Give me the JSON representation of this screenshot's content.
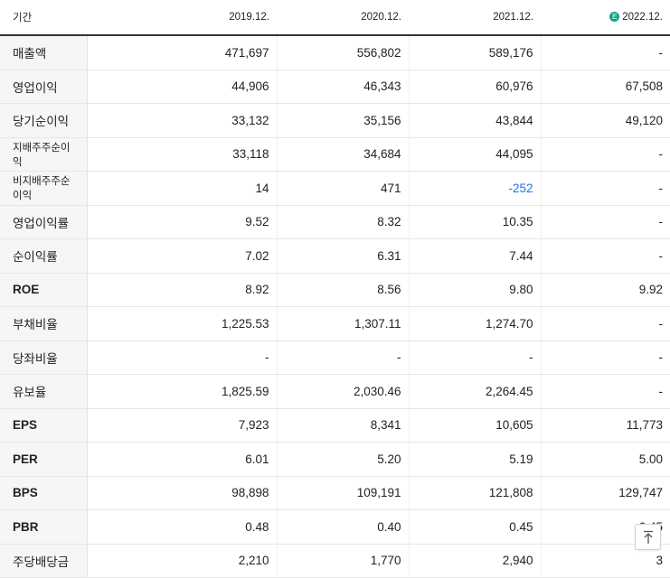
{
  "header": {
    "period_label": "기간",
    "estimate_badge": "E",
    "columns": [
      "2019.12.",
      "2020.12.",
      "2021.12.",
      "2022.12."
    ]
  },
  "rows": [
    {
      "label": "매출액",
      "values": [
        "471,697",
        "556,802",
        "589,176",
        "-"
      ]
    },
    {
      "label": "영업이익",
      "values": [
        "44,906",
        "46,343",
        "60,976",
        "67,508"
      ]
    },
    {
      "label": "당기순이익",
      "values": [
        "33,132",
        "35,156",
        "43,844",
        "49,120"
      ]
    },
    {
      "label": "지배주주순이익",
      "values": [
        "33,118",
        "34,684",
        "44,095",
        "-"
      ]
    },
    {
      "label": "비지배주주순이익",
      "values": [
        "14",
        "471",
        "-252",
        "-"
      ]
    },
    {
      "label": "영업이익률",
      "values": [
        "9.52",
        "8.32",
        "10.35",
        "-"
      ]
    },
    {
      "label": "순이익률",
      "values": [
        "7.02",
        "6.31",
        "7.44",
        "-"
      ]
    },
    {
      "label": "ROE",
      "values": [
        "8.92",
        "8.56",
        "9.80",
        "9.92"
      ]
    },
    {
      "label": "부채비율",
      "values": [
        "1,225.53",
        "1,307.11",
        "1,274.70",
        "-"
      ]
    },
    {
      "label": "당좌비율",
      "values": [
        "-",
        "-",
        "-",
        "-"
      ]
    },
    {
      "label": "유보율",
      "values": [
        "1,825.59",
        "2,030.46",
        "2,264.45",
        "-"
      ]
    },
    {
      "label": "EPS",
      "values": [
        "7,923",
        "8,341",
        "10,605",
        "11,773"
      ]
    },
    {
      "label": "PER",
      "values": [
        "6.01",
        "5.20",
        "5.19",
        "5.00"
      ]
    },
    {
      "label": "BPS",
      "values": [
        "98,898",
        "109,191",
        "121,808",
        "129,747"
      ]
    },
    {
      "label": "PBR",
      "values": [
        "0.48",
        "0.40",
        "0.45",
        "0.45"
      ]
    },
    {
      "label": "주당배당금",
      "values": [
        "2,210",
        "1,770",
        "2,940",
        "3"
      ]
    }
  ],
  "scroll_top_icon": "arrow-up-to-top-icon",
  "colors": {
    "negative": "#1a73e8",
    "estimate_badge": "#0da68a",
    "label_background": "#f6f6f6"
  }
}
